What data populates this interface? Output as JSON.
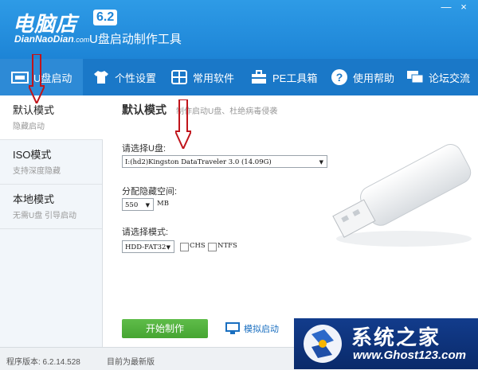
{
  "app": {
    "logo_cn": "电脑店",
    "version_badge": "6.2",
    "logo_en": "DianNaoDian",
    "logo_en_domain": ".com",
    "subtitle": "U盘启动制作工具"
  },
  "window_controls": {
    "minimize": "—",
    "close": "×"
  },
  "nav": [
    {
      "label": "U盘启动",
      "icon": "usb-home-icon",
      "active": true
    },
    {
      "label": "个性设置",
      "icon": "tshirt-icon"
    },
    {
      "label": "常用软件",
      "icon": "grid-apps-icon"
    },
    {
      "label": "PE工具箱",
      "icon": "toolbox-icon"
    },
    {
      "label": "使用帮助",
      "icon": "help-icon"
    },
    {
      "label": "论坛交流",
      "icon": "chat-icon"
    }
  ],
  "sidebar": [
    {
      "title": "默认模式",
      "subtitle": "隐藏启动",
      "active": true
    },
    {
      "title": "ISO模式",
      "subtitle": "支持深度隐藏"
    },
    {
      "title": "本地模式",
      "subtitle": "无需U盘 引导启动"
    }
  ],
  "main": {
    "title": "默认模式",
    "description": "制作启动U盘、杜绝病毒侵袭",
    "select_disk_label": "请选择U盘:",
    "disk_value": "I:(hd2)Kingston DataTraveler 3.0 (14.09G)",
    "hidden_space_label": "分配隐藏空间:",
    "hidden_space_value": "550",
    "hidden_space_unit": "MB",
    "mode_label": "请选择模式:",
    "mode_value": "HDD-FAT32",
    "chs_label": "CHS",
    "ntfs_label": "NTFS",
    "start_button": "开始制作",
    "simulate_button": "模拟启动"
  },
  "status": {
    "version_text": "程序版本: 6.2.14.528",
    "update_text": "目前为最新版"
  },
  "watermark": {
    "title": "系统之家",
    "url": "www.Ghost123.com"
  },
  "colors": {
    "header_blue": "#1d84d6",
    "nav_blue": "#1a78c8",
    "start_green": "#45a531",
    "annotation_red": "#c0141b"
  }
}
